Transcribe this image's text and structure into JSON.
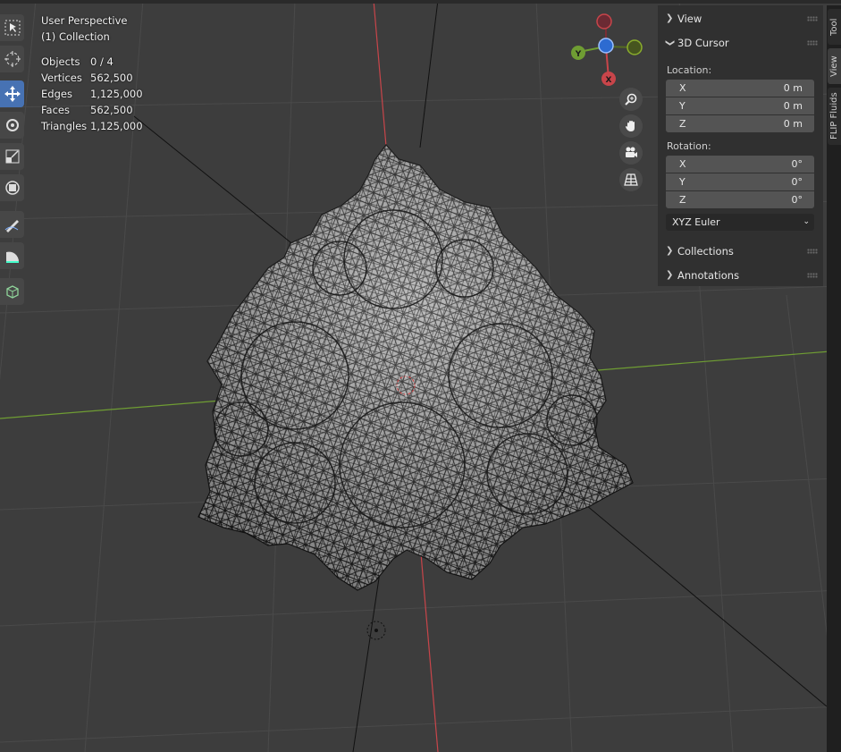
{
  "viewport": {
    "view_name": "User Perspective",
    "collection": "(1) Collection"
  },
  "stats": [
    {
      "label": "Objects",
      "value": "0 / 4"
    },
    {
      "label": "Vertices",
      "value": "562,500"
    },
    {
      "label": "Edges",
      "value": "1,125,000"
    },
    {
      "label": "Faces",
      "value": "562,500"
    },
    {
      "label": "Triangles",
      "value": "1,125,000"
    }
  ],
  "gizmo": {
    "y_label": "Y",
    "x_label": "X"
  },
  "sidebar": {
    "view_label": "View",
    "cursor_label": "3D Cursor",
    "location_label": "Location:",
    "location": [
      {
        "axis": "X",
        "value": "0 m"
      },
      {
        "axis": "Y",
        "value": "0 m"
      },
      {
        "axis": "Z",
        "value": "0 m"
      }
    ],
    "rotation_label": "Rotation:",
    "rotation": [
      {
        "axis": "X",
        "value": "0°"
      },
      {
        "axis": "Y",
        "value": "0°"
      },
      {
        "axis": "Z",
        "value": "0°"
      }
    ],
    "rotation_mode": "XYZ Euler",
    "collections_label": "Collections",
    "annotations_label": "Annotations"
  },
  "tabs": [
    "Tool",
    "View",
    "FLIP Fluids"
  ],
  "colors": {
    "background": "#3d3d3d",
    "x_axis": "#c8454a",
    "y_axis": "#6f9d33",
    "active_tool": "#4772b3"
  }
}
